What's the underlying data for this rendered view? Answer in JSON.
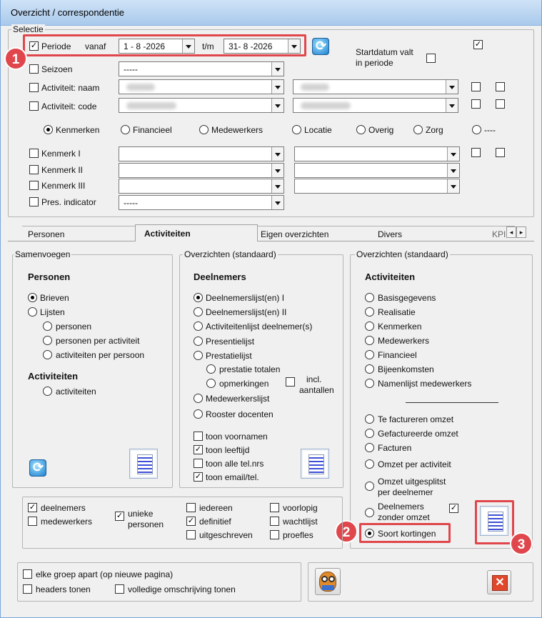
{
  "window": {
    "title": "Overzicht / correspondentie"
  },
  "selectie": {
    "label": "Selectie",
    "periode": {
      "label": "Periode",
      "checked": true,
      "vanaf_label": "vanaf",
      "from": "1 - 8 -2026",
      "tm_label": "t/m",
      "to": "31- 8 -2026"
    },
    "startdatum_line1": "Startdatum valt",
    "startdatum_line2": "in periode",
    "seizoen": {
      "label": "Seizoen",
      "value": "-----"
    },
    "activiteit_naam": {
      "label": "Activiteit: naam"
    },
    "activiteit_code": {
      "label": "Activiteit: code"
    },
    "radios": [
      "Kenmerken",
      "Financieel",
      "Medewerkers",
      "Locatie",
      "Overig",
      "Zorg",
      "----"
    ],
    "kenmerk1": "Kenmerk I",
    "kenmerk2": "Kenmerk II",
    "kenmerk3": "Kenmerk III",
    "pres": {
      "label": "Pres. indicator",
      "value": "-----"
    }
  },
  "tabs": [
    "Personen",
    "Activiteiten",
    "Eigen overzichten",
    "Divers",
    "KPI"
  ],
  "samenvoegen": {
    "label": "Samenvoegen",
    "personen_header": "Personen",
    "brieven": "Brieven",
    "lijsten": "Lijsten",
    "personen": "personen",
    "personen_per_activiteit": "personen per activiteit",
    "activiteiten_per_persoon": "activiteiten per persoon",
    "activiteiten_header": "Activiteiten",
    "activiteiten": "activiteiten"
  },
  "overzichten1": {
    "label": "Overzichten (standaard)",
    "header": "Deelnemers",
    "items": [
      "Deelnemerslijst(en) I",
      "Deelnemerslijst(en) II",
      "Activiteitenlijst deelnemer(s)",
      "Presentielijst",
      "Prestatielijst"
    ],
    "prestatie_totalen": "prestatie totalen",
    "opmerkingen": "opmerkingen",
    "incl": "incl.",
    "aantallen": "aantallen",
    "medewerkerslijst": "Medewerkerslijst",
    "rooster": "Rooster docenten",
    "toon_voornamen": "toon voornamen",
    "toon_leeftijd": "toon leeftijd",
    "toon_alle_tel": "toon alle tel.nrs",
    "toon_email": "toon email/tel."
  },
  "overzichten2": {
    "label": "Overzichten (standaard)",
    "header": "Activiteiten",
    "items": [
      "Basisgegevens",
      "Realisatie",
      "Kenmerken",
      "Medewerkers",
      "Financieel",
      "Bijeenkomsten",
      "Namenlijst medewerkers"
    ],
    "items2": [
      "Te factureren omzet",
      "Gefactureerde omzet",
      "Facturen",
      "Omzet per activiteit"
    ],
    "omzet_uitgesplitst_1": "Omzet uitgesplitst",
    "omzet_uitgesplitst_2": "per deelnemer",
    "deelnemers_zonder_1": "Deelnemers",
    "deelnemers_zonder_2": "zonder omzet",
    "soort_kortingen": "Soort kortingen"
  },
  "filters": {
    "deelnemers": "deelnemers",
    "medewerkers": "medewerkers",
    "unieke_1": "unieke",
    "unieke_2": "personen",
    "iedereen": "iedereen",
    "definitief": "definitief",
    "uitgeschreven": "uitgeschreven",
    "voorlopig": "voorlopig",
    "wachtlijst": "wachtlijst",
    "proefles": "proefles"
  },
  "bottom": {
    "elke_groep": "elke groep apart (op nieuwe pagina)",
    "headers": "headers tonen",
    "volledige": "volledige omschrijving tonen"
  },
  "callouts": [
    "1",
    "2",
    "3"
  ],
  "colors": {
    "accent_red": "#e0474c",
    "title_blue": "#a9c9ec"
  }
}
